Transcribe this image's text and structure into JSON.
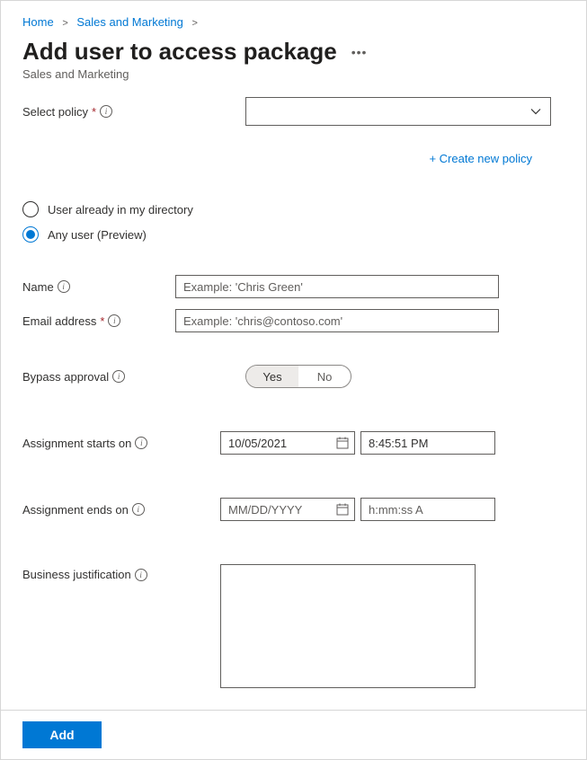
{
  "breadcrumb": {
    "home": "Home",
    "level2": "Sales and Marketing"
  },
  "page_title": "Add user to access package",
  "subtitle": "Sales and Marketing",
  "select_policy": {
    "label": "Select policy",
    "create_link": "+ Create new policy"
  },
  "user_type": {
    "opt1": "User already in my directory",
    "opt2": "Any user (Preview)"
  },
  "name_field": {
    "label": "Name",
    "placeholder": "Example: 'Chris Green'"
  },
  "email_field": {
    "label": "Email address",
    "placeholder": "Example: 'chris@contoso.com'"
  },
  "bypass": {
    "label": "Bypass approval",
    "yes": "Yes",
    "no": "No"
  },
  "starts": {
    "label": "Assignment starts on",
    "date": "10/05/2021",
    "time": "8:45:51 PM"
  },
  "ends": {
    "label": "Assignment ends on",
    "date_placeholder": "MM/DD/YYYY",
    "time_placeholder": "h:mm:ss A"
  },
  "justification": {
    "label": "Business justification"
  },
  "footer": {
    "add": "Add"
  }
}
